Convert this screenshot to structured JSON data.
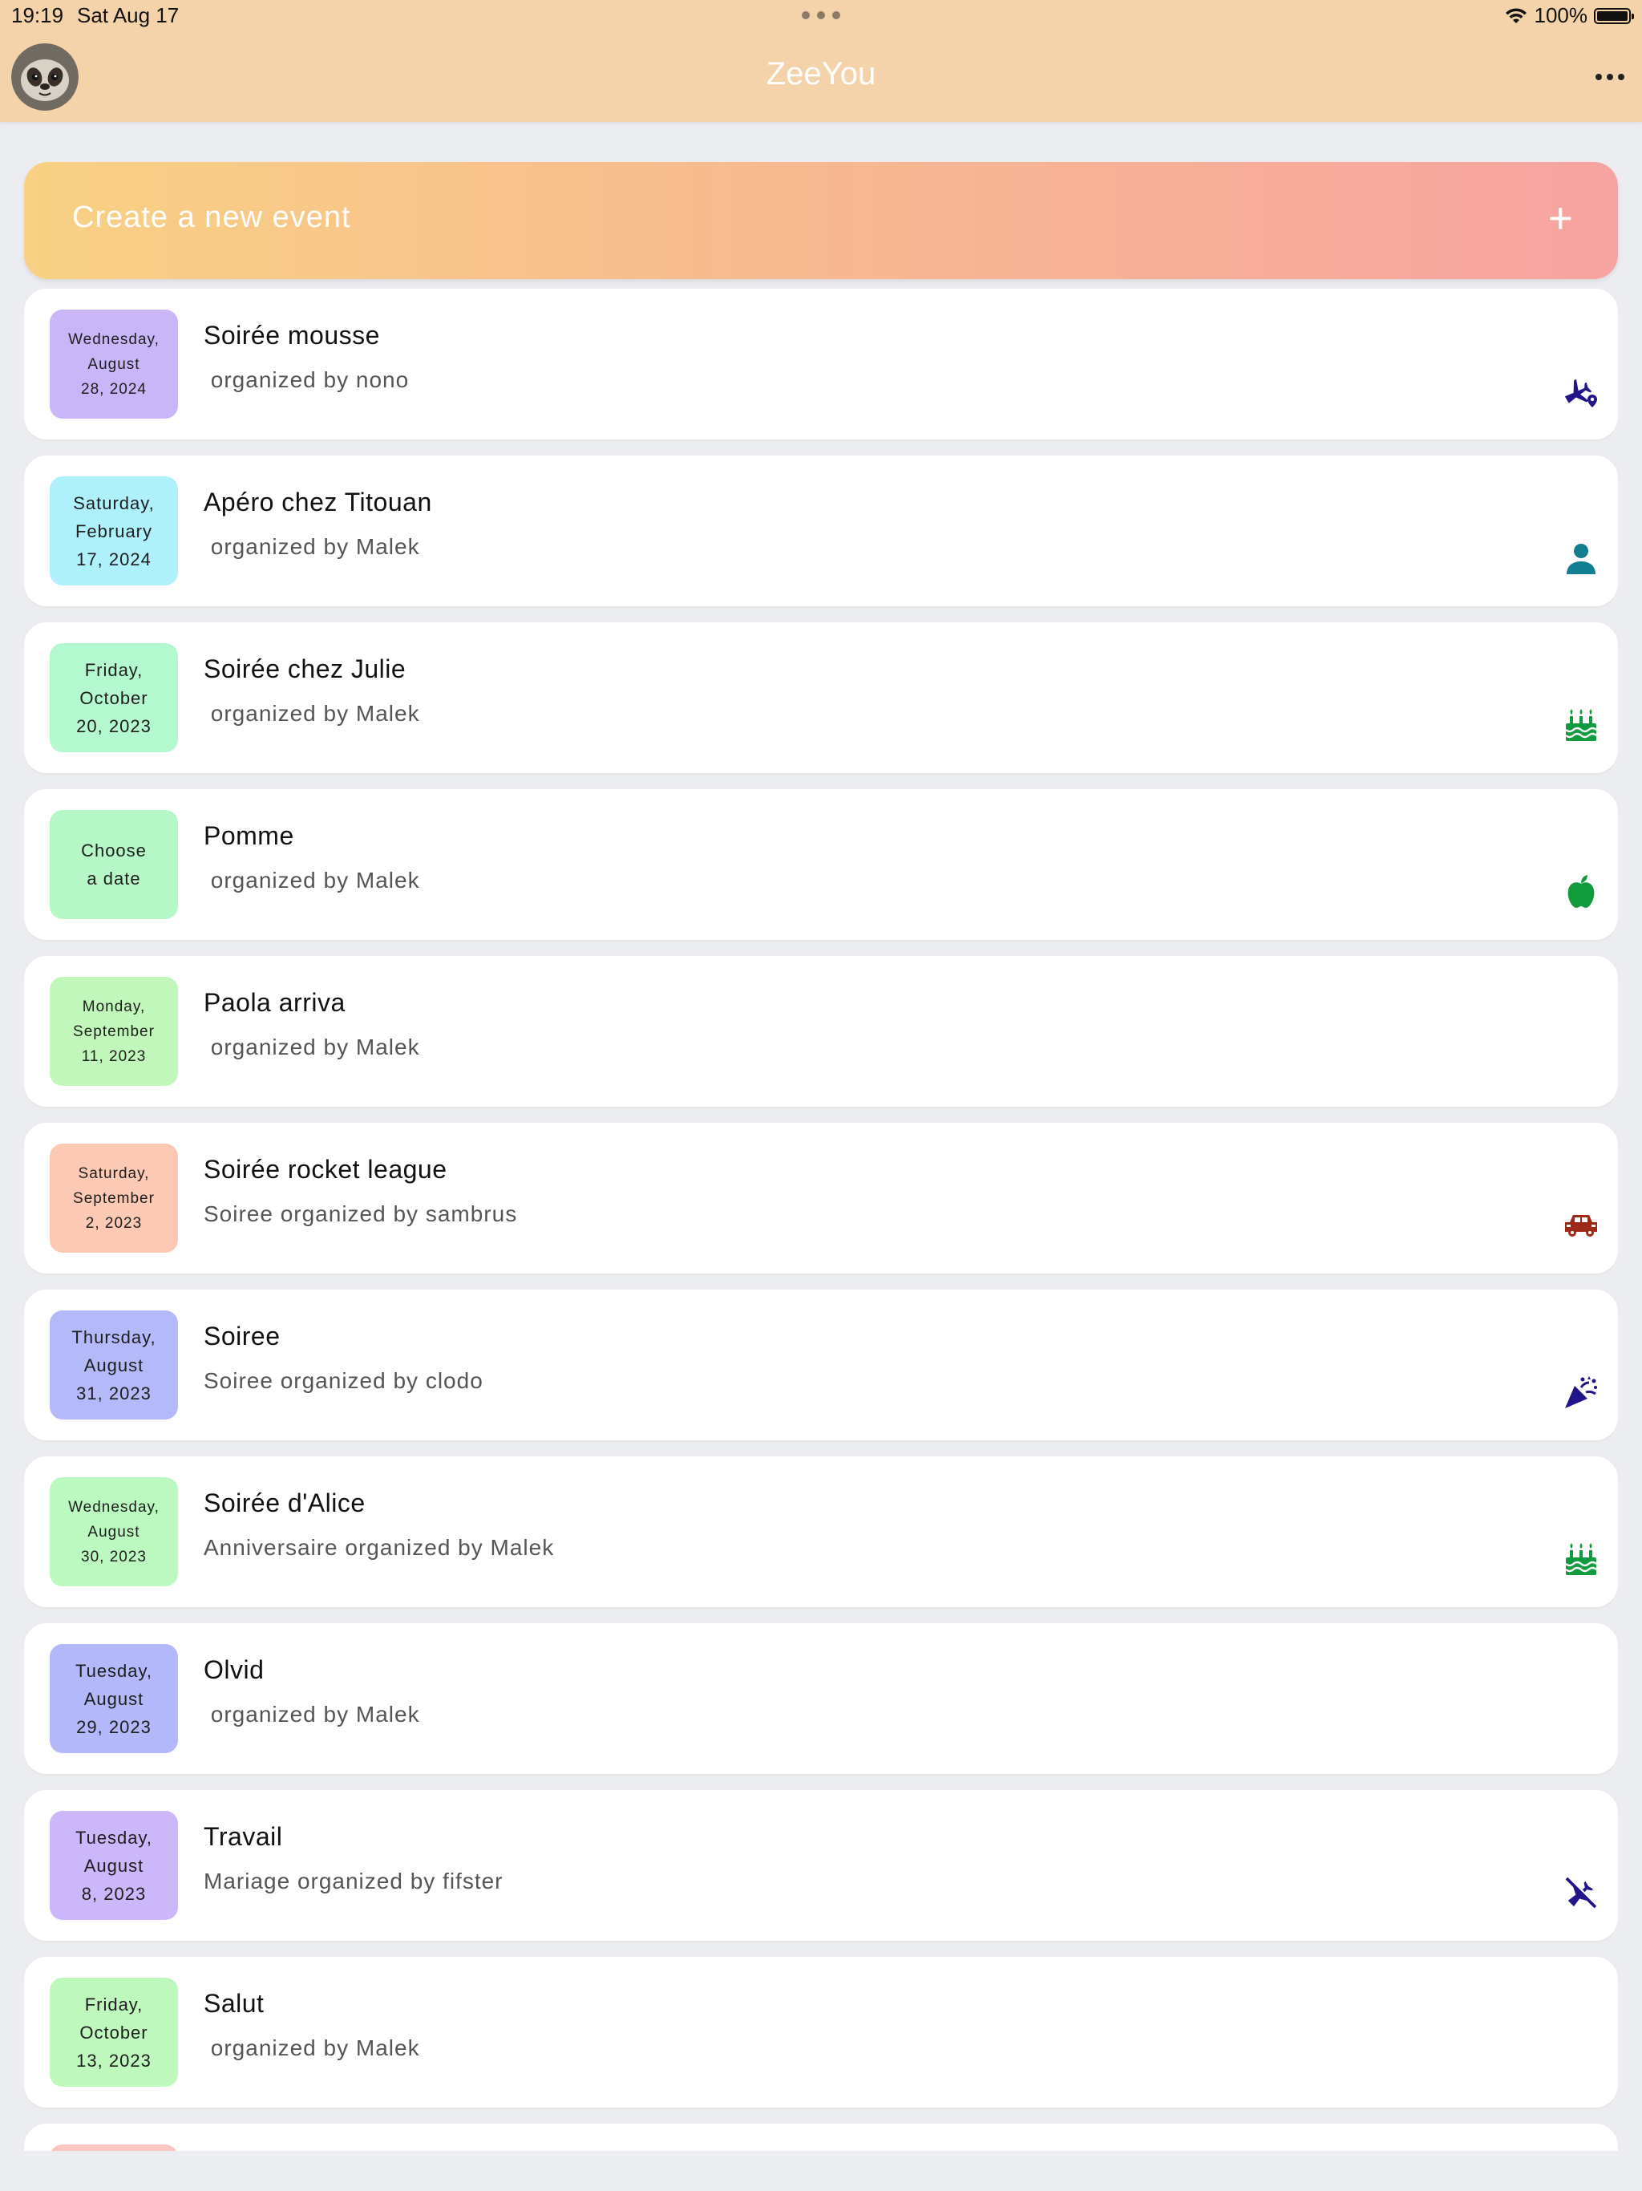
{
  "status_bar": {
    "time": "19:19",
    "date": "Sat Aug 17",
    "battery": "100%"
  },
  "app": {
    "title": "ZeeYou"
  },
  "create_button": {
    "label": "Create a new event",
    "plus": "+",
    "gradient": [
      "#f8d184",
      "#f7bb8f",
      "#f7a3a1"
    ]
  },
  "events": [
    {
      "title": "Soirée mousse",
      "subtitle": " organized by nono",
      "date_lines": [
        "Wednesday,",
        "August",
        "28,  2024"
      ],
      "date_color": "#c9b6f9",
      "small": true,
      "icon": "airplane-pin-icon",
      "icon_color": "#22148a"
    },
    {
      "title": "Apéro chez Titouan",
      "subtitle": " organized by Malek",
      "date_lines": [
        "Saturday,",
        "February",
        "17,  2024"
      ],
      "date_color": "#aef1fb",
      "small": false,
      "icon": "person-icon",
      "icon_color": "#127f91"
    },
    {
      "title": "Soirée chez Julie",
      "subtitle": " organized by Malek",
      "date_lines": [
        "Friday,",
        "October",
        "20,  2023"
      ],
      "date_color": "#b3f8cf",
      "small": false,
      "icon": "cake-icon",
      "icon_color": "#129a3f"
    },
    {
      "title": "Pomme",
      "subtitle": " organized by Malek",
      "date_lines": [
        "Choose",
        "a date"
      ],
      "date_color": "#b6f7c7",
      "small": false,
      "icon": "apple-icon",
      "icon_color": "#129a3f"
    },
    {
      "title": "Paola arriva",
      "subtitle": " organized by Malek",
      "date_lines": [
        "Monday,",
        "September",
        "11,  2023"
      ],
      "date_color": "#c1f7ba",
      "small": true,
      "icon": "",
      "icon_color": ""
    },
    {
      "title": "Soirée rocket league",
      "subtitle": "Soiree organized by sambrus",
      "date_lines": [
        "Saturday,",
        "September",
        "2,  2023"
      ],
      "date_color": "#fbc9b4",
      "small": true,
      "icon": "car-icon",
      "icon_color": "#9c2a16"
    },
    {
      "title": "Soiree",
      "subtitle": "Soiree organized by clodo",
      "date_lines": [
        "Thursday,",
        "August",
        "31,  2023"
      ],
      "date_color": "#b4baf9",
      "small": false,
      "icon": "party-popper-icon",
      "icon_color": "#22148a"
    },
    {
      "title": "Soirée d'Alice",
      "subtitle": "Anniversaire organized by Malek",
      "date_lines": [
        "Wednesday,",
        "August",
        "30,  2023"
      ],
      "date_color": "#bbf9c0",
      "small": true,
      "icon": "cake-icon",
      "icon_color": "#129a3f"
    },
    {
      "title": "Olvid",
      "subtitle": " organized by Malek",
      "date_lines": [
        "Tuesday,",
        "August",
        "29,  2023"
      ],
      "date_color": "#b2b8f9",
      "small": false,
      "icon": "",
      "icon_color": ""
    },
    {
      "title": "Travail",
      "subtitle": "Mariage organized by fifster",
      "date_lines": [
        "Tuesday,",
        "August",
        "8,  2023"
      ],
      "date_color": "#cbb7f9",
      "small": false,
      "icon": "airplane-off-icon",
      "icon_color": "#22148a"
    },
    {
      "title": "Salut",
      "subtitle": " organized by Malek",
      "date_lines": [
        "Friday,",
        "October",
        "13,  2023"
      ],
      "date_color": "#bef8bd",
      "small": false,
      "icon": "",
      "icon_color": ""
    },
    {
      "title": "",
      "subtitle": "",
      "date_lines": [],
      "date_color": "#f9c6c2",
      "small": false,
      "icon": "",
      "icon_color": ""
    }
  ]
}
